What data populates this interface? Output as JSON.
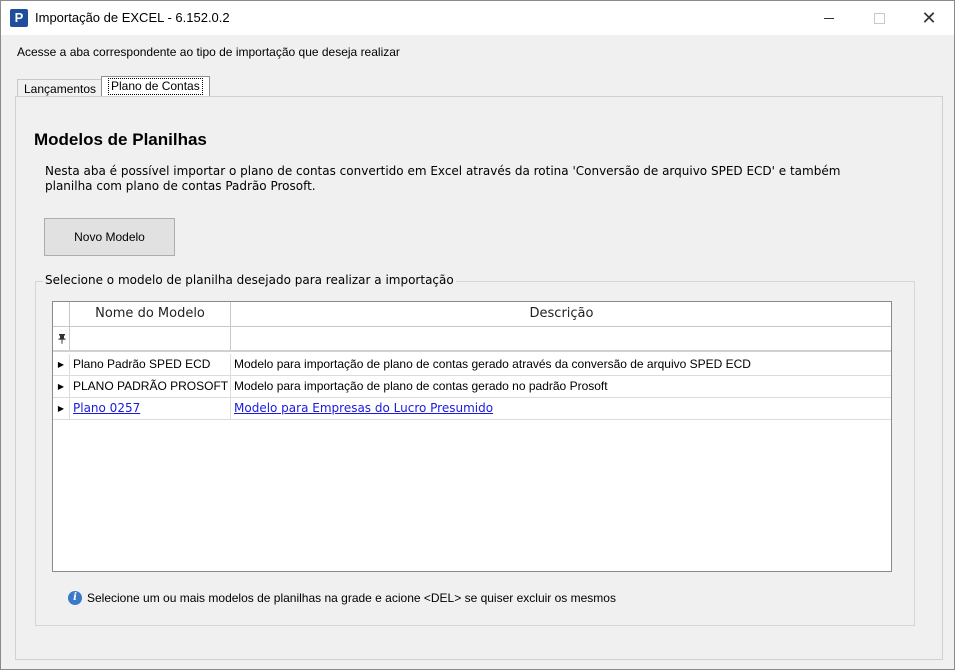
{
  "window": {
    "title": "Importação de EXCEL - 6.152.0.2",
    "app_icon_letter": "P",
    "minimize_icon": "minimize-icon",
    "maximize_icon": "maximize-icon",
    "close_icon": "close-icon",
    "close_glyph": "✕"
  },
  "instruction": "Acesse a aba correspondente ao tipo de importação que deseja realizar",
  "tabs": [
    {
      "label": "Lançamentos",
      "active": false
    },
    {
      "label": "Plano de Contas",
      "active": true
    }
  ],
  "panel": {
    "title": "Modelos de Planilhas",
    "description": "Nesta aba é possível importar o plano de contas convertido em Excel através da rotina 'Conversão de arquivo SPED ECD' e também planilha com plano de contas Padrão Prosoft.",
    "new_model_button": "Novo Modelo",
    "group_label": "Selecione o modelo de planilha desejado para realizar a importação",
    "grid": {
      "columns": [
        "Nome do Modelo",
        "Descrição"
      ],
      "filter_icon": "filter-pin-icon",
      "rows": [
        {
          "name": "Plano Padrão SPED ECD",
          "description": "Modelo para importação de plano de contas gerado através da conversão de arquivo SPED ECD",
          "link": false
        },
        {
          "name": "PLANO PADRÃO PROSOFT",
          "description": "Modelo para importação de plano de contas gerado no padrão Prosoft",
          "link": false
        },
        {
          "name": "Plano 0257",
          "description": "Modelo para Empresas do Lucro Presumido",
          "link": true
        }
      ]
    },
    "hint": "Selecione um ou mais modelos de planilhas na grade e acione <DEL> se quiser excluir os mesmos",
    "hint_icon": "info-icon"
  },
  "colors": {
    "window_bg": "#f0f0f0",
    "link": "#1a1ae0",
    "app_icon": "#1f4e9c",
    "info_icon": "#3a78c8"
  }
}
